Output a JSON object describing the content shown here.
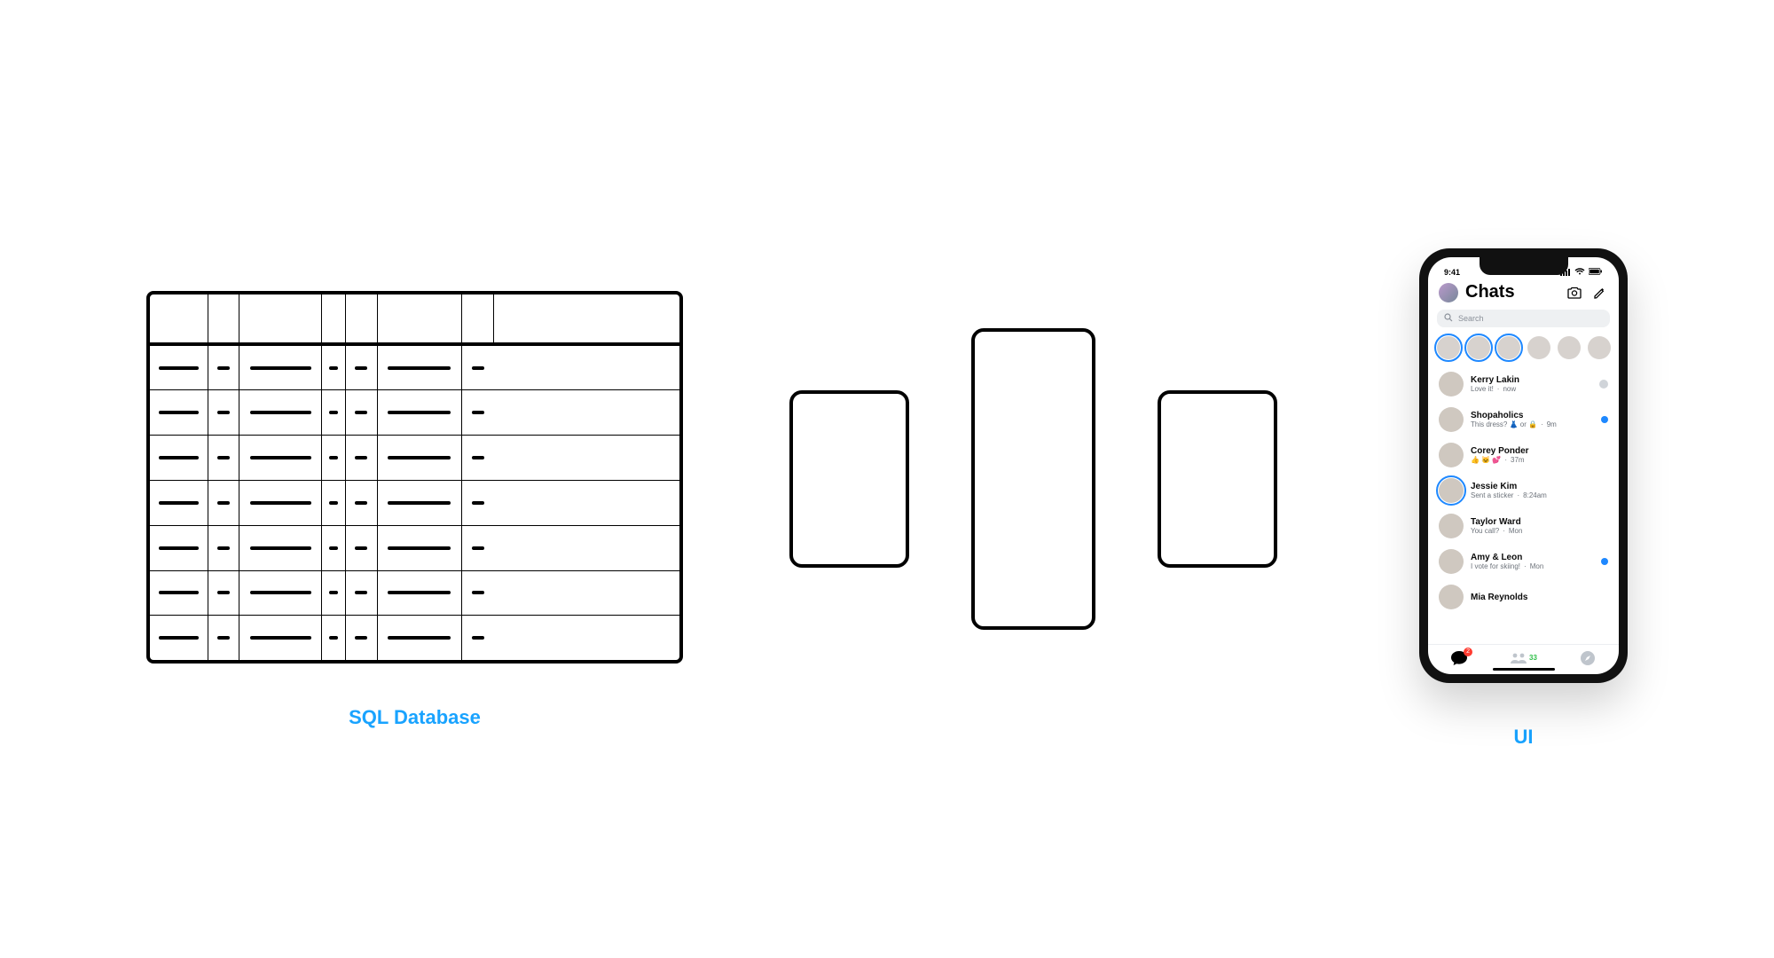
{
  "labels": {
    "database": "SQL Database",
    "ui": "UI"
  },
  "phone": {
    "time": "9:41",
    "header_title": "Chats",
    "search_placeholder": "Search",
    "stories_count": 6,
    "tabbar": {
      "chat_badge": "2",
      "people_count": "33"
    },
    "chats": [
      {
        "name": "Kerry Lakin",
        "sub": "Love it!",
        "time": "now",
        "indicator": "check",
        "ring": false
      },
      {
        "name": "Shopaholics",
        "sub": "This dress? 👗 or 🔒",
        "time": "9m",
        "indicator": "dot",
        "ring": false
      },
      {
        "name": "Corey Ponder",
        "sub": "👍 🐱 💕",
        "time": "37m",
        "indicator": "none",
        "ring": false
      },
      {
        "name": "Jessie Kim",
        "sub": "Sent a sticker",
        "time": "8:24am",
        "indicator": "none",
        "ring": true
      },
      {
        "name": "Taylor Ward",
        "sub": "You call?",
        "time": "Mon",
        "indicator": "none",
        "ring": false
      },
      {
        "name": "Amy & Leon",
        "sub": "I vote for skiing!",
        "time": "Mon",
        "indicator": "dot",
        "ring": false
      },
      {
        "name": "Mia Reynolds",
        "sub": "",
        "time": "",
        "indicator": "none",
        "ring": false
      }
    ]
  },
  "diagram": {
    "db_rows": 7,
    "db_col_pattern": [
      "long",
      "short",
      "mid",
      "short",
      "short",
      "mid",
      "short"
    ],
    "middle_cards": [
      "small",
      "large",
      "small"
    ]
  },
  "colors": {
    "accent_blue_text": "#19a3ff",
    "messenger_blue": "#1e88ff",
    "badge_red": "#ff3b30",
    "people_green": "#2fbf4a"
  }
}
